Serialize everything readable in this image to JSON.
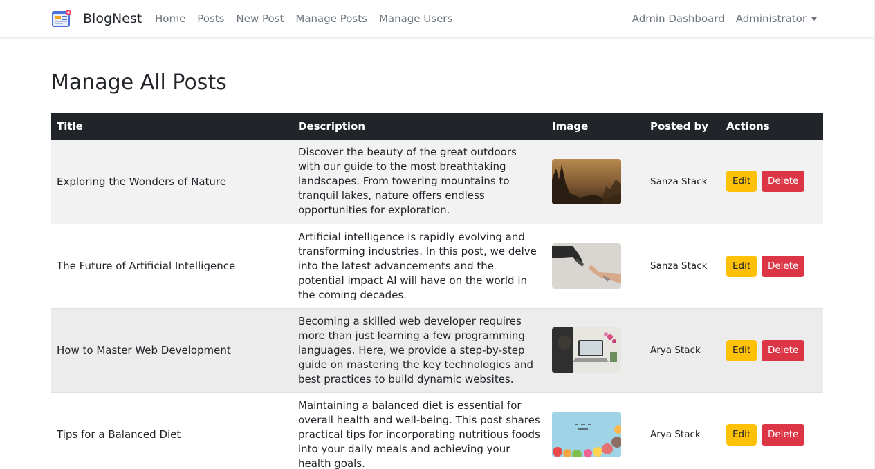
{
  "navbar": {
    "brand": "BlogNest",
    "links": [
      "Home",
      "Posts",
      "New Post",
      "Manage Posts",
      "Manage Users"
    ],
    "right_links": [
      "Admin Dashboard"
    ],
    "user_menu": "Administrator"
  },
  "page": {
    "title": "Manage All Posts"
  },
  "table": {
    "headers": [
      "Title",
      "Description",
      "Image",
      "Posted by",
      "Actions"
    ],
    "rows": [
      {
        "title": "Exploring the Wonders of Nature",
        "description": "Discover the beauty of the great outdoors with our guide to the most breathtaking landscapes. From towering mountains to tranquil lakes, nature offers endless opportunities for exploration.",
        "image": "nature-landscape-thumbnail",
        "posted_by": "Sanza Stack",
        "edit": "Edit",
        "delete": "Delete"
      },
      {
        "title": "The Future of Artificial Intelligence",
        "description": "Artificial intelligence is rapidly evolving and transforming industries. In this post, we delve into the latest advancements and the potential impact AI will have on the world in the coming decades.",
        "image": "robot-human-hands-thumbnail",
        "posted_by": "Sanza Stack",
        "edit": "Edit",
        "delete": "Delete"
      },
      {
        "title": "How to Master Web Development",
        "description": "Becoming a skilled web developer requires more than just learning a few programming languages. Here, we provide a step-by-step guide on mastering the key technologies and best practices to build dynamic websites.",
        "image": "laptop-workspace-thumbnail",
        "posted_by": "Arya Stack",
        "edit": "Edit",
        "delete": "Delete"
      },
      {
        "title": "Tips for a Balanced Diet",
        "description": "Maintaining a balanced diet is essential for overall health and well-being. This post shares practical tips for incorporating nutritious foods into your daily meals and achieving your health goals.",
        "image": "healthy-food-thumbnail",
        "posted_by": "Arya Stack",
        "edit": "Edit",
        "delete": "Delete"
      }
    ]
  },
  "colors": {
    "navbar_bg": "#ffffff",
    "table_header_bg": "#212529",
    "edit_button": "#ffc107",
    "delete_button": "#dc3545",
    "link_muted": "#6c757d"
  }
}
